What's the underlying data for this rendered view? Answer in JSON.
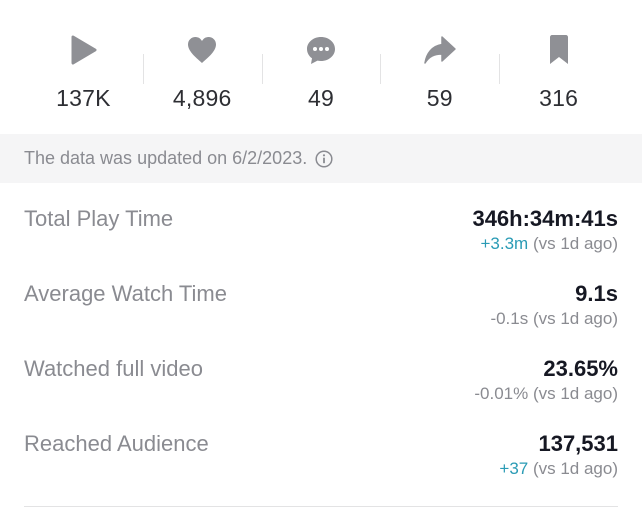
{
  "stats": [
    {
      "name": "views",
      "icon": "play-icon",
      "value": "137K"
    },
    {
      "name": "likes",
      "icon": "heart-icon",
      "value": "4,896"
    },
    {
      "name": "comments",
      "icon": "comment-icon",
      "value": "49"
    },
    {
      "name": "shares",
      "icon": "share-icon",
      "value": "59"
    },
    {
      "name": "saves",
      "icon": "bookmark-icon",
      "value": "316"
    }
  ],
  "notice": {
    "text": "The data was updated on 6/2/2023.",
    "icon": "info-icon"
  },
  "metrics": [
    {
      "label": "Total Play Time",
      "value": "346h:34m:41s",
      "delta": "+3.3m",
      "delta_suffix": " (vs 1d ago)",
      "delta_color": "#2a9bb5"
    },
    {
      "label": "Average Watch Time",
      "value": "9.1s",
      "delta": "-0.1s",
      "delta_suffix": " (vs 1d ago)",
      "delta_color": "#8a8b91"
    },
    {
      "label": "Watched full video",
      "value": "23.65%",
      "delta": "-0.01%",
      "delta_suffix": " (vs 1d ago)",
      "delta_color": "#8a8b91"
    },
    {
      "label": "Reached Audience",
      "value": "137,531",
      "delta": "+37",
      "delta_suffix": " (vs 1d ago)",
      "delta_color": "#2a9bb5"
    }
  ],
  "colors": {
    "icon_gray": "#8f9095",
    "positive": "#2a9bb5",
    "muted_text": "#8a8b91",
    "notice_bg": "#f5f5f6"
  }
}
